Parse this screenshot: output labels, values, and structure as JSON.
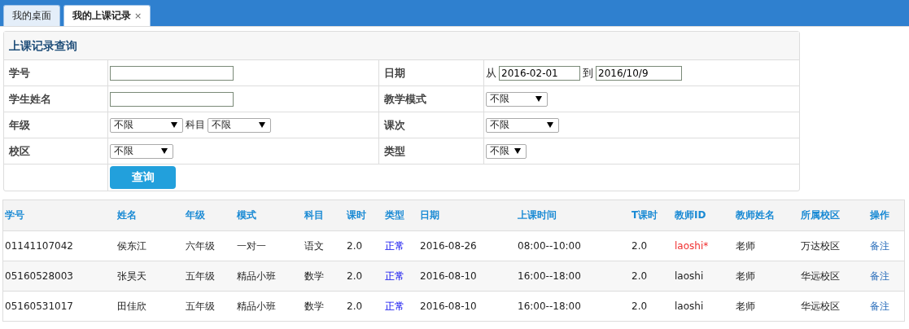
{
  "tabs": [
    {
      "label": "我的桌面",
      "selected": false
    },
    {
      "label": "我的上课记录",
      "selected": true,
      "close": "×"
    }
  ],
  "query": {
    "title": "上课记录查询",
    "rows": [
      {
        "left": {
          "label": "学号",
          "kind": "text"
        },
        "right": {
          "label": "日期",
          "kind": "date_range",
          "from_label": "从",
          "from": "2016-02-01",
          "to_label": "到",
          "to": "2016/10/9"
        }
      },
      {
        "left": {
          "label": "学生姓名",
          "kind": "text"
        },
        "right": {
          "label": "教学模式",
          "kind": "select",
          "value": "不限"
        }
      },
      {
        "left": {
          "label": "年级",
          "kind": "select_pair",
          "value": "不限",
          "second_label": "科目",
          "second_value": "不限"
        },
        "right": {
          "label": "课次",
          "kind": "select",
          "value": "不限"
        }
      },
      {
        "left": {
          "label": "校区",
          "kind": "select",
          "value": "不限"
        },
        "right": {
          "label": "类型",
          "kind": "select",
          "value": "不限"
        }
      }
    ],
    "button": "查询"
  },
  "table": {
    "columns": [
      "学号",
      "姓名",
      "年级",
      "模式",
      "科目",
      "课时",
      "类型",
      "日期",
      "上课时间",
      "T课时",
      "教师ID",
      "教师姓名",
      "所属校区",
      "操作"
    ],
    "rows": [
      {
        "cells": [
          "01141107042",
          "侯东江",
          "六年级",
          "一对一",
          "语文",
          "2.0",
          "正常",
          "2016-08-26",
          "08:00--10:00",
          "2.0",
          "laoshi*",
          "老师",
          "万达校区",
          "备注"
        ],
        "flagged": true
      },
      {
        "cells": [
          "05160528003",
          "张昊天",
          "五年级",
          "精品小班",
          "数学",
          "2.0",
          "正常",
          "2016-08-10",
          "16:00--18:00",
          "2.0",
          "laoshi",
          "老师",
          "华远校区",
          "备注"
        ],
        "flagged": false
      },
      {
        "cells": [
          "05160531017",
          "田佳欣",
          "五年级",
          "精品小班",
          "数学",
          "2.0",
          "正常",
          "2016-08-10",
          "16:00--18:00",
          "2.0",
          "laoshi",
          "老师",
          "华远校区",
          "备注"
        ],
        "flagged": false
      }
    ]
  }
}
